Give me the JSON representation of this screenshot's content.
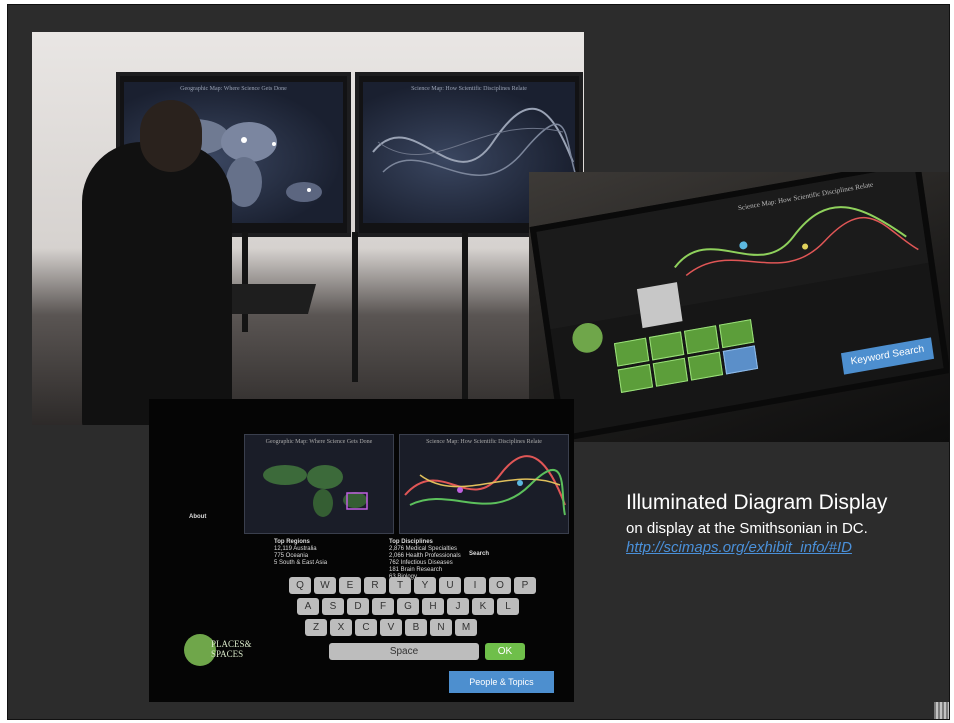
{
  "caption": {
    "title": "Illuminated Diagram Display",
    "subtitle": "on display at the Smithsonian  in DC.",
    "link": "http://scimaps.org/exhibit_info/#ID"
  },
  "photo_wall": {
    "left_screen_title": "Geographic Map: Where Science Gets Done",
    "right_screen_title": "Science Map: How Scientific Disciplines Relate"
  },
  "photo_touch": {
    "right_title": "Science Map: How Scientific Disciplines Relate",
    "button_label": "Keyword Search"
  },
  "photo_kiosk": {
    "left_title": "Geographic Map: Where Science Gets Done",
    "right_title": "Science Map: How Scientific Disciplines Relate",
    "about_heading": "About",
    "regions_heading": "Top Regions",
    "regions": [
      "12,119  Australia",
      "775  Oceania",
      "5  South & East Asia"
    ],
    "disciplines_heading": "Top Disciplines",
    "disciplines": [
      "2,876  Medical Specialties",
      "2,066  Health Professionals",
      "762  Infectious Diseases",
      "181  Brain Research",
      "63  Biology"
    ],
    "search_heading": "Search",
    "logo_line1": "PLACES&",
    "logo_line2": "SPACES",
    "keyboard_rows": [
      "QWERTYUIOP",
      "ASDFGHJKL",
      "ZXCVBNM"
    ],
    "space_label": "Space",
    "ok_label": "OK",
    "people_topics_label": "People & Topics"
  }
}
